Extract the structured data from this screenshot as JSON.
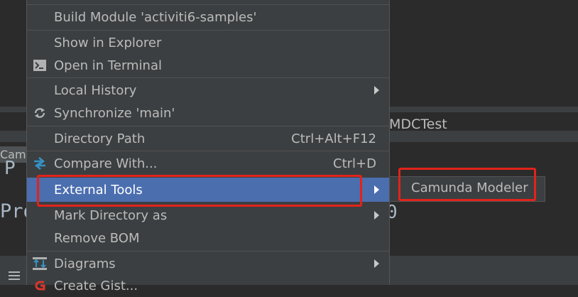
{
  "background": {
    "tab_label": "MDCTest",
    "cut_tab_label": "Cam",
    "editor_char_p": "P",
    "editor_text_pro": "Pro",
    "editor_text_zero": "0"
  },
  "context_menu": {
    "items": [
      {
        "label": "Build Module 'activiti6-samples'"
      },
      {
        "label": "Show in Explorer"
      },
      {
        "label": "Open in Terminal",
        "icon": "terminal-icon"
      },
      {
        "label": "Local History",
        "submenu": true
      },
      {
        "label": "Synchronize 'main'",
        "icon": "sync-icon"
      },
      {
        "label": "Directory Path",
        "shortcut": "Ctrl+Alt+F12"
      },
      {
        "label": "Compare With...",
        "icon": "compare-icon",
        "shortcut": "Ctrl+D"
      },
      {
        "label": "External Tools",
        "submenu": true,
        "selected": true
      },
      {
        "label": "Mark Directory as",
        "submenu": true
      },
      {
        "label": "Remove BOM"
      },
      {
        "label": "Diagrams",
        "icon": "diagrams-icon",
        "submenu": true
      },
      {
        "label": "Create Gist...",
        "icon": "gist-icon"
      }
    ]
  },
  "submenu": {
    "items": [
      {
        "label": "Camunda Modeler"
      }
    ]
  },
  "colors": {
    "selection": "#4b6eaf",
    "highlight": "#e2231a",
    "menu_bg": "#3c3f41"
  }
}
